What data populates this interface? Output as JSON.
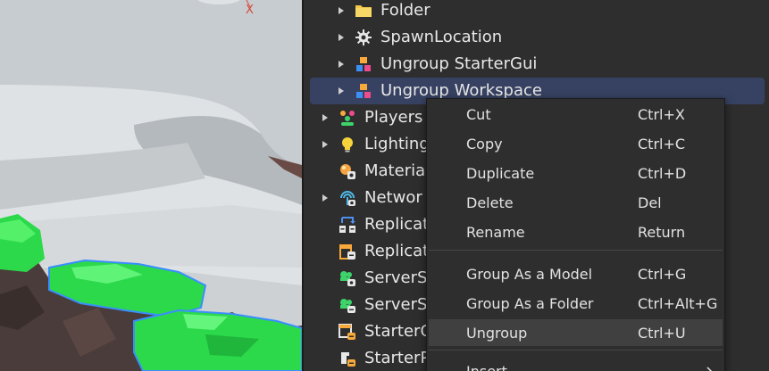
{
  "viewport": {
    "axis_label": "X"
  },
  "explorer": {
    "items": [
      {
        "label": "Folder",
        "icon": "folder-icon",
        "selected": false
      },
      {
        "label": "SpawnLocation",
        "icon": "spawn-location-icon",
        "selected": false
      },
      {
        "label": "Ungroup StarterGui",
        "icon": "blocks-icon",
        "selected": false
      },
      {
        "label": "Ungroup Workspace",
        "icon": "blocks-icon",
        "selected": true
      },
      {
        "label": "Players",
        "icon": "players-icon",
        "selected": false
      },
      {
        "label": "Lighting",
        "icon": "lightbulb-icon",
        "selected": false
      },
      {
        "label": "Material",
        "icon": "material-service-icon",
        "selected": false
      },
      {
        "label": "Networ",
        "icon": "network-icon",
        "selected": false
      },
      {
        "label": "Replicat",
        "icon": "replicated-first-icon",
        "selected": false
      },
      {
        "label": "Replicat",
        "icon": "replicated-storage-icon",
        "selected": false
      },
      {
        "label": "ServerS",
        "icon": "server-script-service-icon",
        "selected": false
      },
      {
        "label": "ServerS",
        "icon": "server-storage-icon",
        "selected": false
      },
      {
        "label": "StarterG",
        "icon": "starter-gui-icon",
        "selected": false
      },
      {
        "label": "StarterP",
        "icon": "starter-pack-icon",
        "selected": false
      }
    ]
  },
  "context_menu": {
    "items": [
      {
        "label": "Cut",
        "shortcut": "Ctrl+X"
      },
      {
        "label": "Copy",
        "shortcut": "Ctrl+C"
      },
      {
        "label": "Duplicate",
        "shortcut": "Ctrl+D"
      },
      {
        "label": "Delete",
        "shortcut": "Del"
      },
      {
        "label": "Rename",
        "shortcut": "Return"
      },
      {
        "label": "Group As a Model",
        "shortcut": "Ctrl+G"
      },
      {
        "label": "Group As a Folder",
        "shortcut": "Ctrl+Alt+G"
      },
      {
        "label": "Ungroup",
        "shortcut": "Ctrl+U",
        "hovered": true
      },
      {
        "label": "Insert",
        "shortcut": ""
      }
    ]
  },
  "colors": {
    "panel_bg": "#2e2e2e",
    "selection_bg": "#374262",
    "hover_bg": "#404040",
    "text": "#e8e8e8"
  }
}
